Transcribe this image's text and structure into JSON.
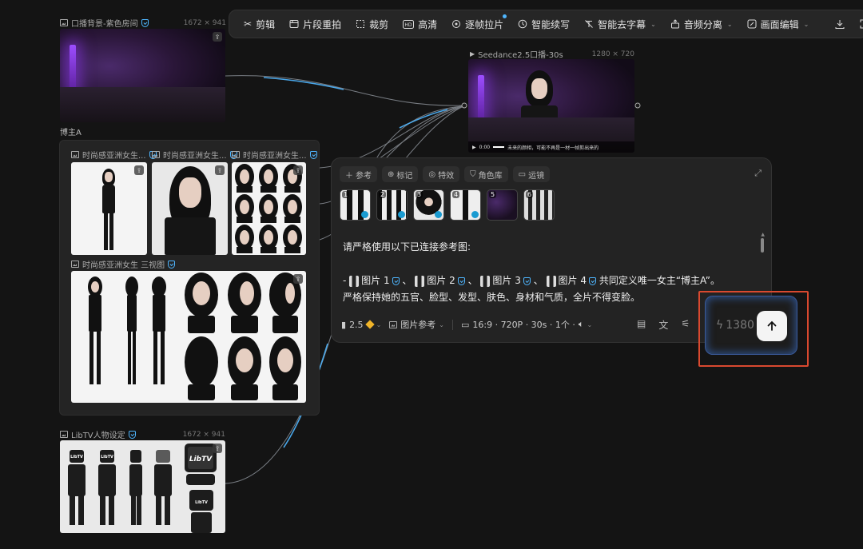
{
  "toolbar": {
    "items": [
      {
        "label": "剪辑",
        "icon": "scissors-icon"
      },
      {
        "label": "片段重拍",
        "icon": "clip-reshoot-icon"
      },
      {
        "label": "裁剪",
        "icon": "crop-icon"
      },
      {
        "label": "高清",
        "icon": "hd-icon"
      },
      {
        "label": "逐帧拉片",
        "icon": "frame-by-frame-icon"
      },
      {
        "label": "智能续写",
        "icon": "smart-continue-icon"
      },
      {
        "label": "智能去字幕",
        "icon": "remove-subtitle-icon"
      },
      {
        "label": "音频分离",
        "icon": "audio-split-icon"
      },
      {
        "label": "画面编辑",
        "icon": "edit-frame-icon"
      }
    ]
  },
  "nodes": {
    "bg": {
      "title": "口播背景-紫色房间",
      "size": "1672 × 941",
      "caption": "博主A"
    },
    "video": {
      "title": "Seedance2.5口播-30s",
      "size": "1280 × 720",
      "subtitle": "未来的颜相，可能不再是一材一帧剪出来的",
      "time": "0:00"
    },
    "group": {
      "labels": [
        "时尚感亚洲女生...",
        "时尚感亚洲女生...",
        "时尚感亚洲女生..."
      ],
      "sheet_label": "时尚感亚洲女生 三视图"
    },
    "libtv": {
      "title": "LibTV人物设定",
      "size": "1672 × 941",
      "logo": "LibTV"
    }
  },
  "prompt": {
    "chips": [
      "参考",
      "标记",
      "特效",
      "角色库",
      "运镜"
    ],
    "refs": [
      "1",
      "2",
      "3",
      "4",
      "5",
      "6"
    ],
    "line1": "请严格使用以下已连接参考图:",
    "line2_dash": "-",
    "img1": "图片 1",
    "img2": "图片 2",
    "img3": "图片 3",
    "img4": "图片 4",
    "sep": "、",
    "line2_tail": "共同定义唯一女主“博主A”。",
    "line3": "严格保持她的五官、脸型、发型、肤色、身材和气质，全片不得变脸。",
    "model": "2.5",
    "ref_mode": "图片参考",
    "video_settings": "16:9 · 720P · 30s · 1个 ·",
    "credits": "1380"
  },
  "colors": {
    "accent": "#4fb6ff",
    "highlight": "#d9492f",
    "background": "#141414"
  }
}
